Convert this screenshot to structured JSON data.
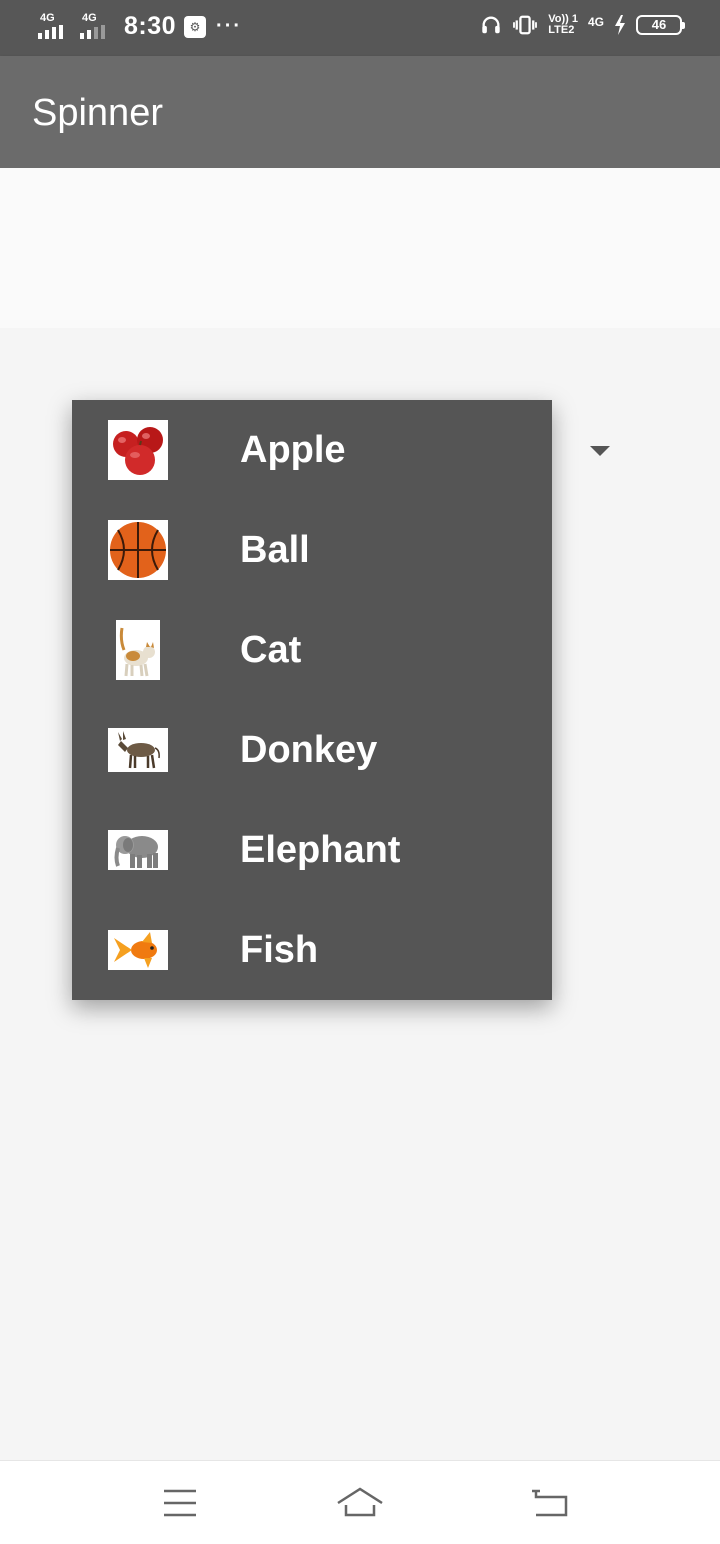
{
  "status_bar": {
    "sim1_network": "4G",
    "sim2_network": "4G",
    "time": "8:30",
    "overflow": "···",
    "volte_line1": "Vo)) 1",
    "volte_line2": "LTE2",
    "data_network": "4G",
    "battery_level": "46"
  },
  "app_bar": {
    "title": "Spinner"
  },
  "dropdown": {
    "items": [
      {
        "label": "Apple",
        "icon": "apple-icon"
      },
      {
        "label": "Ball",
        "icon": "basketball-icon"
      },
      {
        "label": "Cat",
        "icon": "cat-icon"
      },
      {
        "label": "Donkey",
        "icon": "donkey-icon"
      },
      {
        "label": "Elephant",
        "icon": "elephant-icon"
      },
      {
        "label": "Fish",
        "icon": "goldfish-icon"
      }
    ]
  },
  "nav_bar": {
    "buttons": [
      "menu-icon",
      "home-icon",
      "back-icon"
    ]
  },
  "colors": {
    "status_bar": "#575757",
    "app_bar": "#6b6b6b",
    "dropdown_bg": "#555555",
    "content_bg": "#f5f5f5"
  }
}
